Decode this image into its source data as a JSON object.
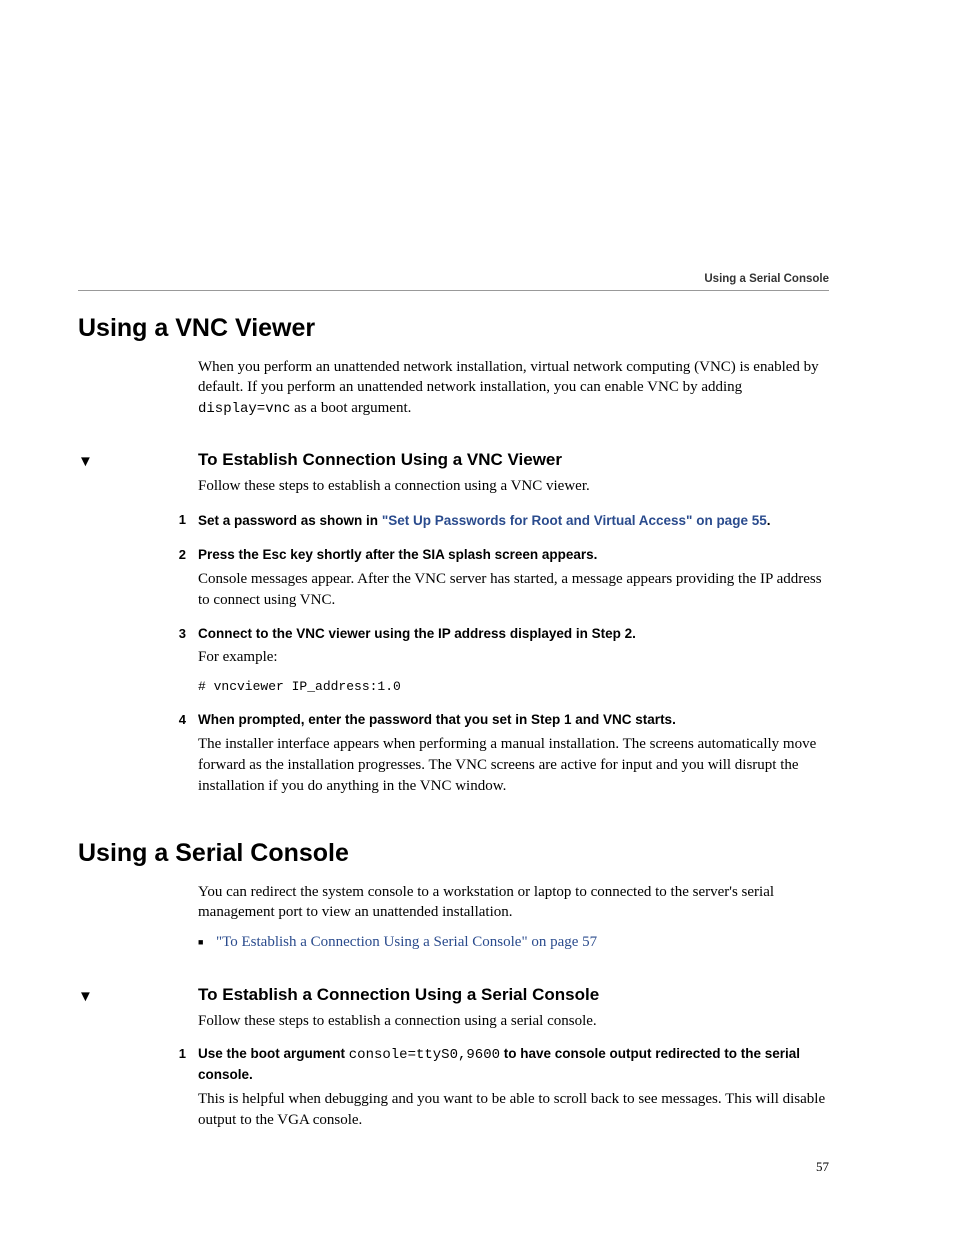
{
  "runningHeader": "Using a Serial Console",
  "pageNumber": "57",
  "section1": {
    "title": "Using a VNC Viewer",
    "intro_pre": "When you perform an unattended network installation, virtual network computing (VNC) is enabled by default. If you perform an unattended network installation, you can enable VNC by adding ",
    "intro_code": "display=vnc",
    "intro_post": " as a boot argument.",
    "task": {
      "heading": "To Establish Connection Using a VNC Viewer",
      "lead": "Follow these steps to establish a connection using a VNC viewer.",
      "steps": {
        "s1": {
          "num": "1",
          "lead_pre": "Set a password as shown in ",
          "xref": "\"Set Up Passwords for Root and Virtual Access\" on page 55",
          "lead_post": "."
        },
        "s2": {
          "num": "2",
          "lead": "Press the Esc key shortly after the SIA splash screen appears.",
          "body": "Console messages appear. After the VNC server has started, a message appears providing the IP address to connect using VNC."
        },
        "s3": {
          "num": "3",
          "lead": "Connect to the VNC viewer using the IP address displayed in Step 2.",
          "body": "For example:",
          "code": "# vncviewer IP_address:1.0"
        },
        "s4": {
          "num": "4",
          "lead": "When prompted, enter the password that you set in Step 1 and VNC starts.",
          "body": "The installer interface appears when performing a manual installation. The screens automatically move forward as the installation progresses. The VNC screens are active for input and you will disrupt the installation if you do anything in the VNC window."
        }
      }
    }
  },
  "section2": {
    "title": "Using a Serial Console",
    "intro": "You can redirect the system console to a workstation or laptop to connected to the server's serial management port to view an unattended installation.",
    "bullet_xref": "\"To Establish a Connection Using a Serial Console\" on page 57",
    "task": {
      "heading": "To Establish a Connection Using a Serial Console",
      "lead": "Follow these steps to establish a connection using a serial console.",
      "steps": {
        "s1": {
          "num": "1",
          "lead_pre": "Use the boot argument ",
          "lead_code": "console=ttyS0,9600",
          "lead_post": " to have console output redirected to the serial console.",
          "body": "This is helpful when debugging and you want to be able to scroll back to see messages. This will disable output to the VGA console."
        }
      }
    }
  }
}
